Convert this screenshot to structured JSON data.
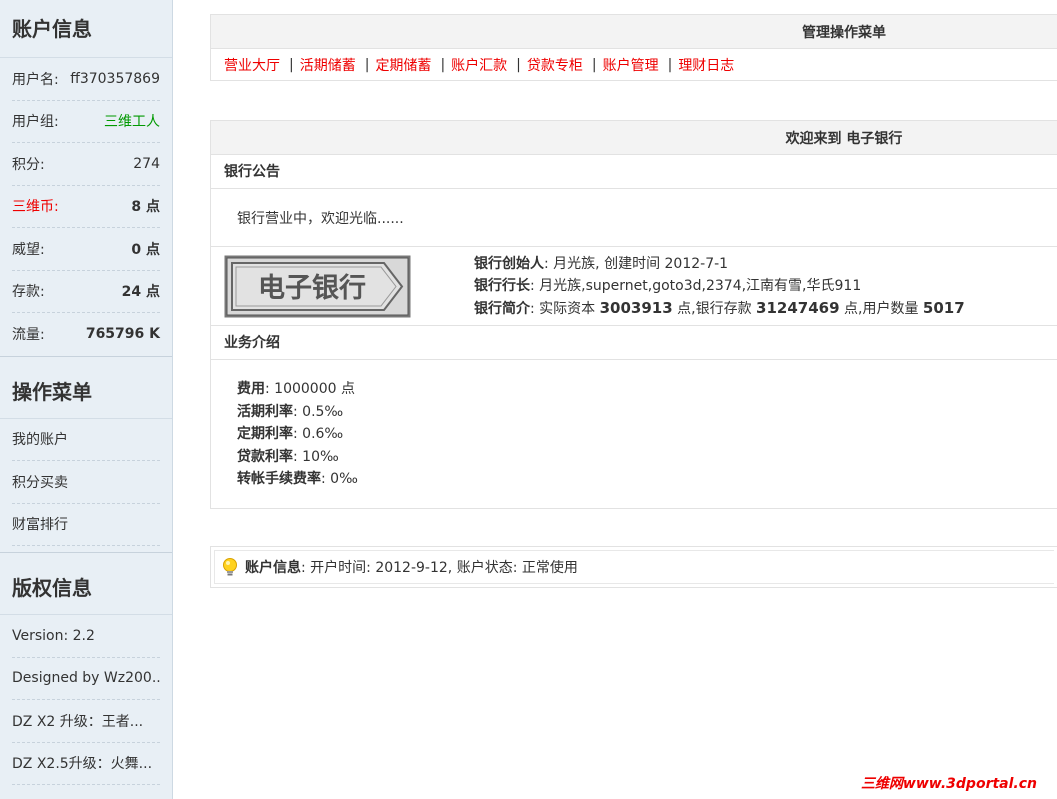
{
  "account": {
    "title": "账户信息",
    "rows": [
      {
        "label": "用户名:",
        "value": "ff370357869"
      },
      {
        "label": "用户组:",
        "value": "三维工人"
      },
      {
        "label": "积分:",
        "value": "274"
      },
      {
        "label": "三维币:",
        "value": "8 点"
      },
      {
        "label": "威望:",
        "value": "0 点"
      },
      {
        "label": "存款:",
        "value": "24 点"
      },
      {
        "label": "流量:",
        "value": "765796 K"
      }
    ]
  },
  "ops_menu": {
    "title": "操作菜单",
    "items": [
      "我的账户",
      "积分买卖",
      "财富排行"
    ]
  },
  "copyright": {
    "title": "版权信息",
    "items": [
      "Version: 2.2",
      "Designed by Wz200...",
      "DZ X2 升级：王者...",
      "DZ X2.5升级：火舞..."
    ]
  },
  "manage": {
    "title": "管理操作菜单",
    "links": [
      "营业大厅",
      "活期储蓄",
      "定期储蓄",
      "账户汇款",
      "贷款专柜",
      "账户管理",
      "理财日志"
    ],
    "separator": "|"
  },
  "welcome": {
    "title": "欢迎来到 电子银行",
    "notice_title": "银行公告",
    "notice_text": "银行营业中，欢迎光临......",
    "logo_text": "电子银行",
    "founder_label": "银行创始人",
    "founder_value": ": 月光族, 创建时间 2012-7-1",
    "president_label": "银行行长",
    "president_value": ": 月光族,supernet,goto3d,2374,江南有雪,华氏911",
    "intro_label": "银行简介",
    "intro_prefix": ": 实际资本 ",
    "capital": "3003913",
    "intro_mid": " 点,银行存款 ",
    "deposits": "31247469",
    "intro_mid2": " 点,用户数量 ",
    "users": "5017",
    "biz_title": "业务介绍",
    "biz": [
      {
        "label": "费用",
        "value": ": 1000000 点"
      },
      {
        "label": "活期利率",
        "value": ": 0.5‰"
      },
      {
        "label": "定期利率",
        "value": ": 0.6‰"
      },
      {
        "label": "贷款利率",
        "value": ": 10‰"
      },
      {
        "label": "转帐手续费率",
        "value": ": 0‰"
      }
    ]
  },
  "status": {
    "label": "账户信息",
    "value": ": 开户时间: 2012-9-12, 账户状态: 正常使用"
  },
  "watermark": "三维网www.3dportal.cn"
}
